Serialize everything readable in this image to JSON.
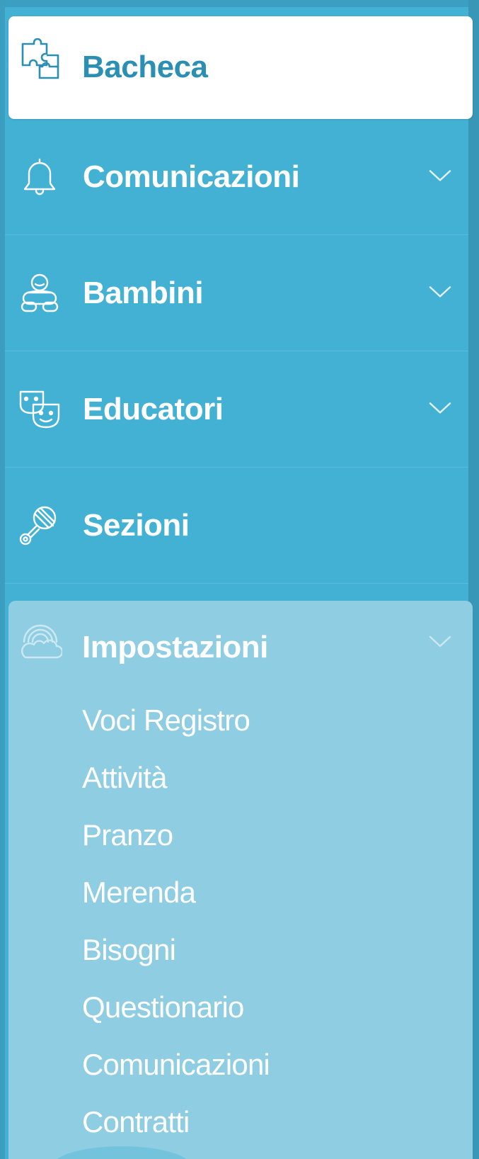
{
  "menu": {
    "items": [
      {
        "label": "Bacheca",
        "icon": "puzzle-icon",
        "active": true,
        "expandable": false
      },
      {
        "label": "Comunicazioni",
        "icon": "bell-icon",
        "expandable": true
      },
      {
        "label": "Bambini",
        "icon": "baby-icon",
        "expandable": true
      },
      {
        "label": "Educatori",
        "icon": "masks-icon",
        "expandable": true
      },
      {
        "label": "Sezioni",
        "icon": "rattle-icon",
        "expandable": false
      },
      {
        "label": "Impostazioni",
        "icon": "rainbow-cloud-icon",
        "expandable": true,
        "expanded": true,
        "subitems": [
          "Voci Registro",
          "Attività",
          "Pranzo",
          "Merenda",
          "Bisogni",
          "Questionario",
          "Comunicazioni",
          "Contratti"
        ]
      }
    ]
  },
  "colors": {
    "sidebar_bg": "#43b1d3",
    "active_bg": "#ffffff",
    "active_text": "#2b8fb4",
    "expanded_bg": "#8ecde2",
    "text": "#ffffff"
  }
}
